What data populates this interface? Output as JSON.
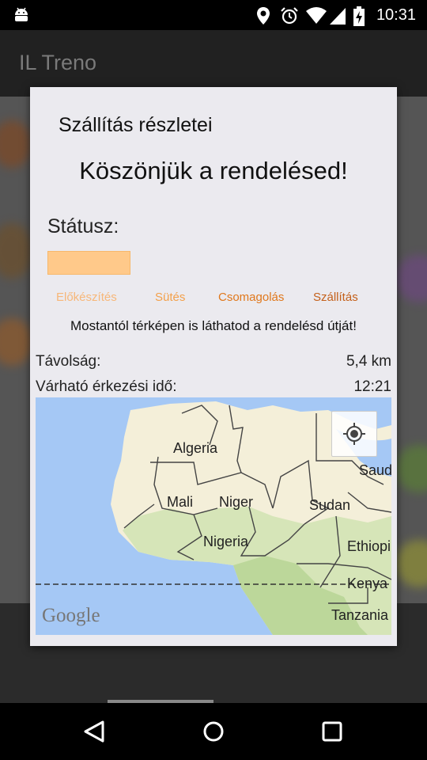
{
  "status_bar": {
    "time": "10:31",
    "icons": [
      "android-icon",
      "location-icon",
      "alarm-icon",
      "wifi-icon",
      "signal-icon",
      "battery-charging-icon"
    ]
  },
  "app_bar": {
    "title": "IL Treno"
  },
  "dialog": {
    "title": "Szállítás részletei",
    "thanks": "Köszönjük a rendelésed!",
    "status_label": "Státusz:",
    "progress_fraction": 0.25,
    "steps": [
      {
        "label": "Előkészítés",
        "color": "#f7b779"
      },
      {
        "label": "Sütés",
        "color": "#f3a04a"
      },
      {
        "label": "Csomagolás",
        "color": "#e0781c"
      },
      {
        "label": "Szállítás",
        "color": "#c4601a"
      }
    ],
    "map_info": "Mostantól térképen is láthatod a rendelésd útját!",
    "distance_label": "Távolság:",
    "distance_value": "5,4 km",
    "eta_label": "Várható érkezési idő:",
    "eta_value": "12:21"
  },
  "map": {
    "labels": [
      "Algeria",
      "Saud",
      "Mali",
      "Niger",
      "Sudan",
      "Nigeria",
      "Ethiopi",
      "Kenya",
      "Tanzania"
    ],
    "attribution": "Google",
    "colors": {
      "water": "#a5c8f5",
      "desert": "#f4efd9",
      "green": "#d6e5b8",
      "forest": "#bcd79a"
    }
  },
  "nav": {
    "buttons": [
      "back-icon",
      "home-icon",
      "recents-icon"
    ]
  }
}
